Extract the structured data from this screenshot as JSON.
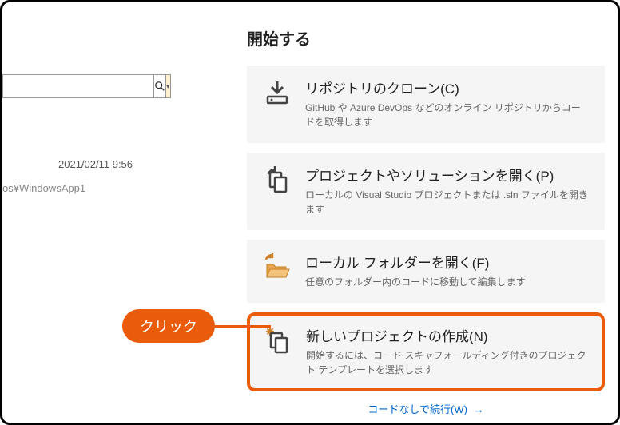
{
  "left": {
    "search_placeholder": "",
    "recent_date": "2021/02/11 9:56",
    "recent_path": "os¥WindowsApp1"
  },
  "start": {
    "title": "開始する",
    "cards": [
      {
        "title": "リポジトリのクローン(C)",
        "desc": "GitHub や Azure DevOps などのオンライン リポジトリからコードを取得します"
      },
      {
        "title": "プロジェクトやソリューションを開く(P)",
        "desc": "ローカルの Visual Studio プロジェクトまたは .sln ファイルを開きます"
      },
      {
        "title": "ローカル フォルダーを開く(F)",
        "desc": "任意のフォルダー内のコードに移動して編集します"
      },
      {
        "title": "新しいプロジェクトの作成(N)",
        "desc": "開始するには、コード スキャフォールディング付きのプロジェクト テンプレートを選択します"
      }
    ],
    "continue_link": "コードなしで続行(W)"
  },
  "callout": {
    "label": "クリック"
  }
}
